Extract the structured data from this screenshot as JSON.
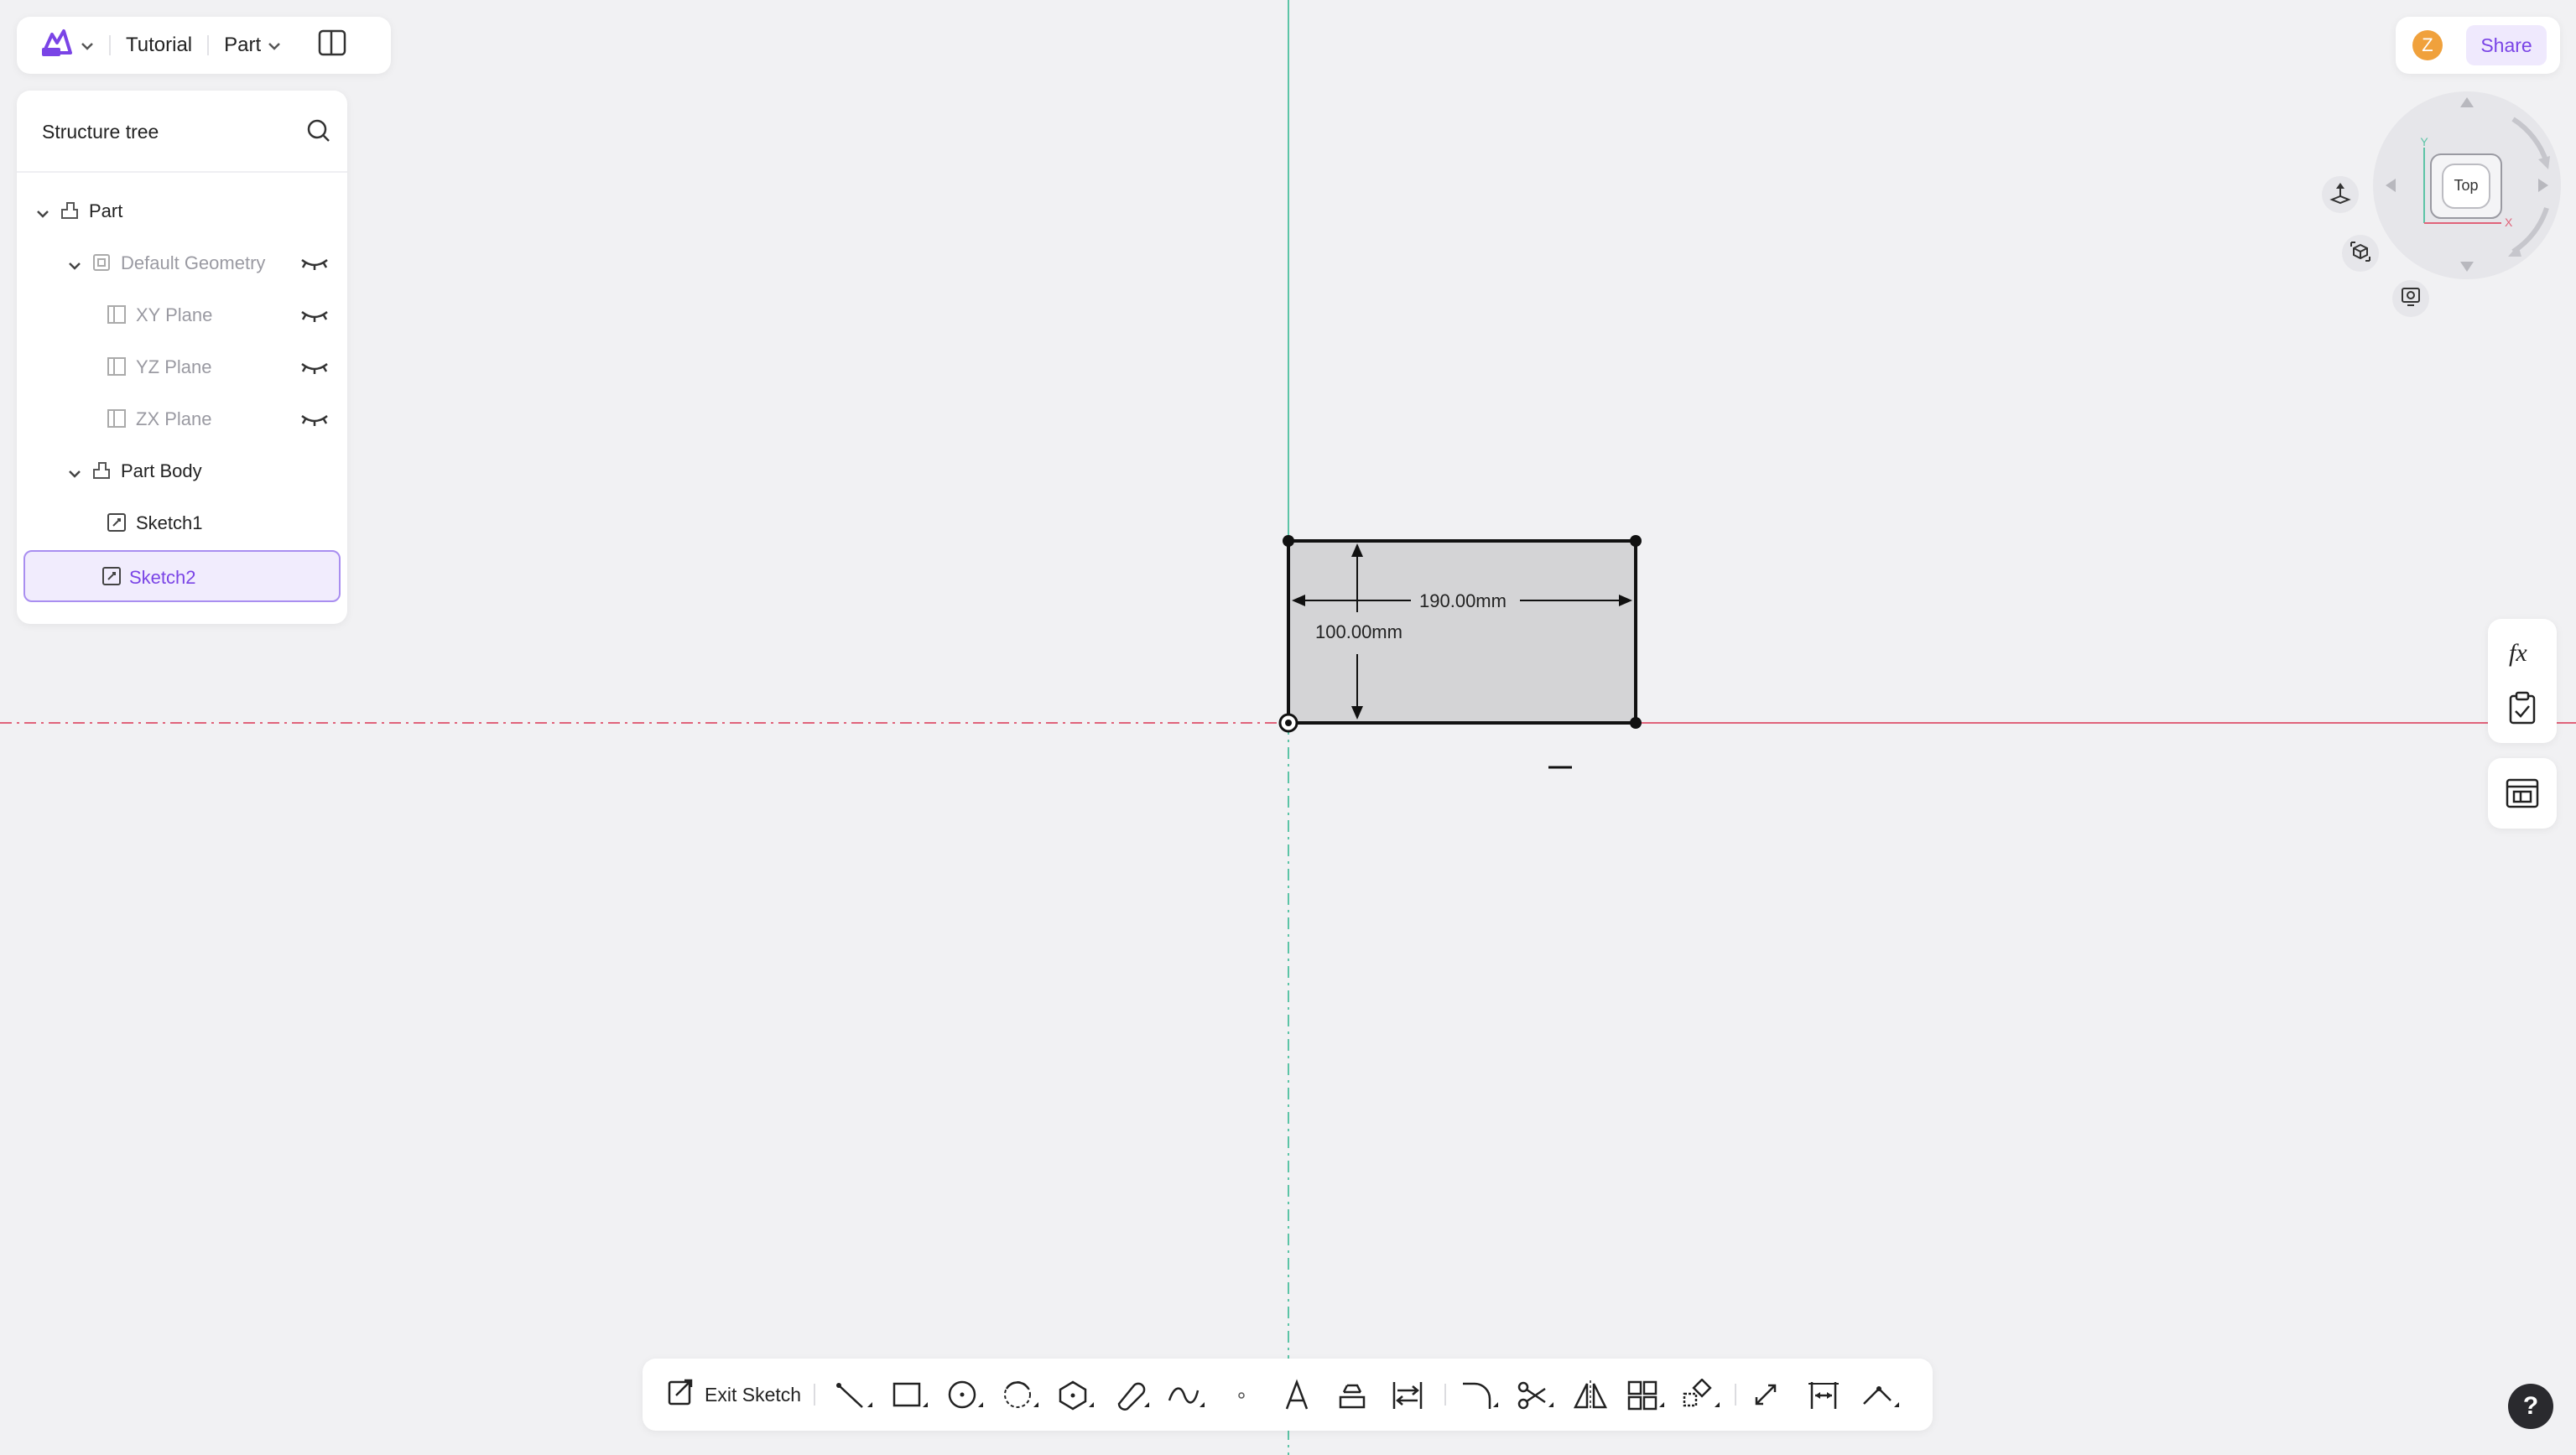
{
  "header": {
    "project_name": "Tutorial",
    "mode_label": "Part",
    "logo_icon": "app-logo-icon",
    "panel_toggle_icon": "panel-layout-icon"
  },
  "tree": {
    "title": "Structure tree",
    "nodes": [
      {
        "label": "Part",
        "icon": "part-icon",
        "expanded": true
      },
      {
        "label": "Default Geometry",
        "icon": "geometry-icon",
        "expanded": true,
        "hidden": true
      },
      {
        "label": "XY Plane",
        "icon": "plane-icon",
        "hidden": true
      },
      {
        "label": "YZ Plane",
        "icon": "plane-icon",
        "hidden": true
      },
      {
        "label": "ZX Plane",
        "icon": "plane-icon",
        "hidden": true
      },
      {
        "label": "Part Body",
        "icon": "part-body-icon",
        "expanded": true
      },
      {
        "label": "Sketch1",
        "icon": "sketch-icon"
      },
      {
        "label": "Sketch2",
        "icon": "sketch-icon",
        "selected": true
      }
    ]
  },
  "share": {
    "avatar_initial": "Z",
    "share_label": "Share"
  },
  "view_cube": {
    "face_label": "Top",
    "axis_y": "Y",
    "axis_x": "X"
  },
  "sketch": {
    "width_dimension": "190.00mm",
    "height_dimension": "100.00mm"
  },
  "toolbar": {
    "exit_label": "Exit Sketch",
    "tools": [
      "line-tool",
      "rectangle-tool",
      "circle-tool",
      "arc-tool",
      "polygon-tool",
      "slot-tool",
      "spline-tool",
      "point-tool",
      "text-tool",
      "project-tool",
      "convert-tool",
      "fillet-tool",
      "trim-tool",
      "mirror-tool",
      "pattern-tool",
      "transform-tool",
      "offset-tool",
      "dimension-tool",
      "constraint-tool"
    ]
  },
  "help_label": "?",
  "colors": {
    "accent": "#7a44e6",
    "x_axis": "#e0637a",
    "y_axis": "#5cc4a6",
    "sketch_fill": "#d4d4d6"
  }
}
